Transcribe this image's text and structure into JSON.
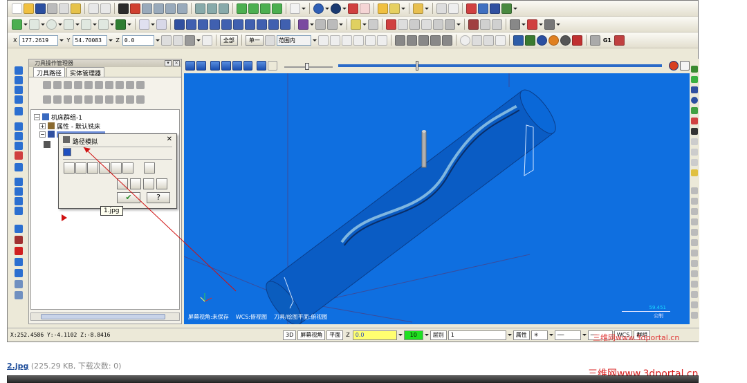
{
  "toolbar3": {
    "x_label": "X",
    "x_value": "177.2619",
    "y_label": "Y",
    "y_value": "54.70083",
    "z_label": "Z",
    "z_value": "0.0",
    "all_btn": "全部",
    "single_btn": "单一",
    "range_label": "范围内",
    "g1_label": "G1"
  },
  "manager": {
    "title": "刀具操作管理器",
    "tabs": [
      "刀具路径",
      "实体管理器"
    ],
    "tree": {
      "group": "机床群组-1",
      "props": "属性 - 默认铣床"
    }
  },
  "dialog": {
    "title": "路径模拟"
  },
  "tooltip": "1.jpg",
  "viewport": {
    "status": [
      "屏幕视角:未保存",
      "WCS:俯视图",
      "刀具/绘图平面:俯视图"
    ],
    "scale_value": "59.451",
    "scale_unit": "公制",
    "bg_color": "#0f6fe0"
  },
  "statusbar": {
    "coords": "X:252.4586  Y:-4.1102  Z:-8.8416",
    "mode_3d": "3D",
    "screen_view": "屏幕视角",
    "plane": "平面",
    "z_label": "Z",
    "z_value": "0.0",
    "level_value": "10",
    "level_label": "层别",
    "level_num": "1",
    "attr_label": "属性",
    "wcs_label": "WCS",
    "group_label": "群组"
  },
  "caption": {
    "filename": "2.jpg",
    "meta": "(225.29 KB, 下载次数: 0)"
  },
  "watermark_top": "三维网www.3dportal.cn",
  "watermark_bottom": "三维网www.3dportal.cn"
}
